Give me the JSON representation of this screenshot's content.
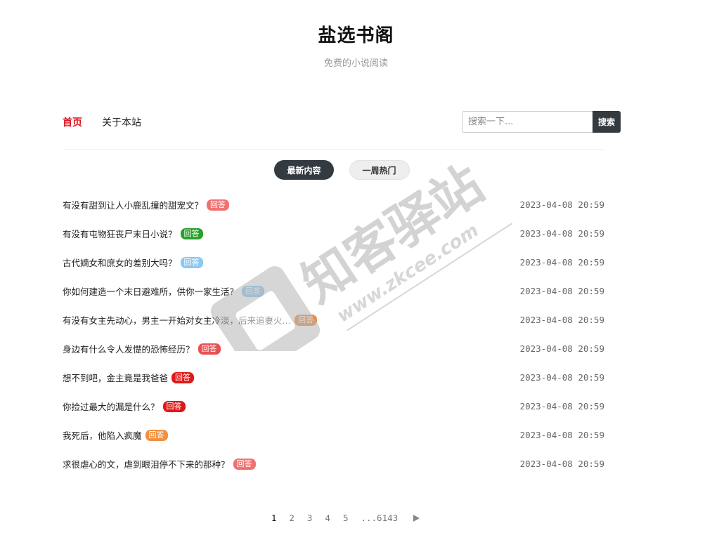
{
  "site": {
    "title": "盐选书阁",
    "subtitle": "免费的小说阅读"
  },
  "nav": {
    "items": [
      {
        "label": "首页",
        "active": true
      },
      {
        "label": "关于本站",
        "active": false
      }
    ]
  },
  "search": {
    "placeholder": "搜索一下...",
    "button_label": "搜索"
  },
  "tabs": [
    {
      "label": "最新内容",
      "active": true
    },
    {
      "label": "一周热门",
      "active": false
    }
  ],
  "posts": [
    {
      "title": "有没有甜到让人小鹿乱撞的甜宠文？",
      "badge": "回答",
      "badge_color": "#f07070",
      "date": "2023-04-08 20:59"
    },
    {
      "title": "有没有屯物狂丧尸末日小说？",
      "badge": "回答",
      "badge_color": "#2aa02a",
      "date": "2023-04-08 20:59"
    },
    {
      "title": "古代嫡女和庶女的差别大吗？",
      "badge": "回答",
      "badge_color": "#8ec8f0",
      "date": "2023-04-08 20:59"
    },
    {
      "title": "你如何建造一个末日避难所，供你一家生活？",
      "badge": "回答",
      "badge_color": "#8ec8f0",
      "date": "2023-04-08 20:59"
    },
    {
      "title": "有没有女主先动心，男主一开始对女主冷淡，后来追妻火…",
      "badge": "回答",
      "badge_color": "#f08a40",
      "date": "2023-04-08 20:59"
    },
    {
      "title": "身边有什么令人发憷的恐怖经历？",
      "badge": "回答",
      "badge_color": "#e85050",
      "date": "2023-04-08 20:59"
    },
    {
      "title": "想不到吧，金主竟是我爸爸",
      "badge": "回答",
      "badge_color": "#e01818",
      "date": "2023-04-08 20:59"
    },
    {
      "title": "你捡过最大的漏是什么？",
      "badge": "回答",
      "badge_color": "#e01818",
      "date": "2023-04-08 20:59"
    },
    {
      "title": "我死后，他陷入疯魔",
      "badge": "回答",
      "badge_color": "#f09040",
      "date": "2023-04-08 20:59"
    },
    {
      "title": "求很虐心的文，虐到眼泪停不下来的那种？",
      "badge": "回答",
      "badge_color": "#f07070",
      "date": "2023-04-08 20:59"
    }
  ],
  "pagination": {
    "pages": [
      "1",
      "2",
      "3",
      "4",
      "5"
    ],
    "current": "1",
    "last": "...6143",
    "next_icon": "triangle-right-icon"
  },
  "watermark": {
    "brand": "知客驿站",
    "url": "www.zkcee.com"
  }
}
